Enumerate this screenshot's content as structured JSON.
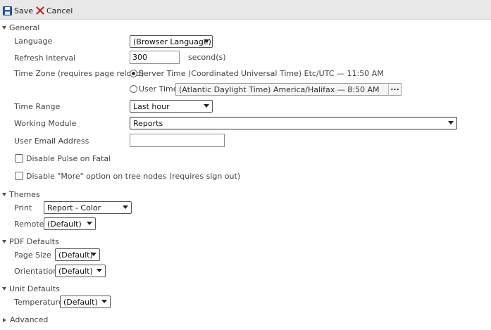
{
  "toolbar": {
    "save_label": "Save",
    "cancel_label": "Cancel"
  },
  "sections": {
    "general": "General",
    "themes": "Themes",
    "pdf_defaults": "PDF Defaults",
    "unit_defaults": "Unit Defaults",
    "advanced": "Advanced"
  },
  "general": {
    "language_label": "Language",
    "language_value": "(Browser Language)",
    "refresh_label": "Refresh Interval",
    "refresh_value": "300",
    "refresh_unit": "second(s)",
    "timezone_label": "Time Zone (requires page reload)",
    "server_time_label": "Server Time (Coordinated Universal Time) Etc/UTC — 11:50 AM",
    "user_time_label": "User Time",
    "user_time_value": "(Atlantic Daylight Time) America/Halifax — 8:50 AM",
    "user_time_button": "...",
    "timerange_label": "Time Range",
    "timerange_value": "Last hour",
    "module_label": "Working Module",
    "module_value": "Reports",
    "email_label": "User Email Address",
    "email_value": "",
    "disable_pulse_label": "Disable Pulse on Fatal",
    "disable_more_label": "Disable \"More\" option on tree nodes (requires sign out)"
  },
  "themes": {
    "print_label": "Print",
    "print_value": "Report - Color",
    "remote_label": "Remote",
    "remote_value": "(Default)"
  },
  "pdf": {
    "pagesize_label": "Page Size",
    "pagesize_value": "(Default)",
    "orientation_label": "Orientation",
    "orientation_value": "(Default)"
  },
  "units": {
    "temperature_label": "Temperature",
    "temperature_value": "(Default)"
  },
  "colors": {
    "save_icon": "#2a5db0",
    "cancel_icon": "#cc2222",
    "toolbar_bg": "#e8e8e8"
  }
}
